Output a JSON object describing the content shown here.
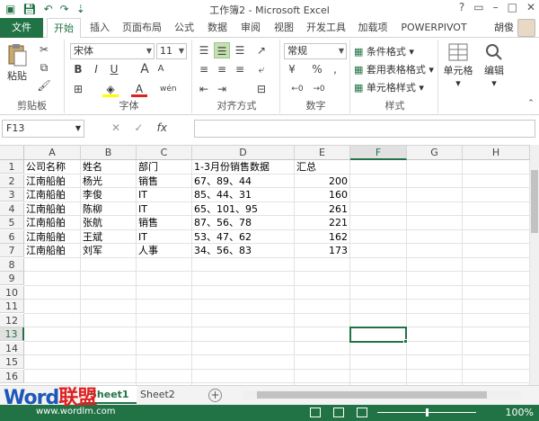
{
  "window": {
    "title": "工作簿2 - Microsoft Excel"
  },
  "tabs": [
    "开始",
    "插入",
    "页面布局",
    "公式",
    "数据",
    "审阅",
    "视图",
    "开发工具",
    "加载项",
    "POWERPIVOT"
  ],
  "file_tab": "文件",
  "user": "胡俊",
  "ribbon": {
    "clipboard": {
      "label": "剪贴板",
      "paste": "粘贴"
    },
    "font": {
      "label": "字体",
      "name": "宋体",
      "size": "11",
      "bold": "B",
      "italic": "I",
      "underline": "U",
      "grow": "A",
      "shrink": "A",
      "color_letter": "A",
      "ex": "wén"
    },
    "align": {
      "label": "对齐方式"
    },
    "number": {
      "label": "数字",
      "format": "常规",
      "percent": "%",
      "comma": ","
    },
    "styles": {
      "label": "样式",
      "cond": "条件格式",
      "table": "套用表格格式",
      "cell": "单元格样式"
    },
    "cells": {
      "label": "单元格"
    },
    "edit": {
      "label": "编辑"
    }
  },
  "formula_bar": {
    "name_box": "F13",
    "fx": "fx",
    "value": ""
  },
  "grid": {
    "columns": [
      "A",
      "B",
      "C",
      "D",
      "E",
      "F",
      "G",
      "H"
    ],
    "rows": [
      "1",
      "2",
      "3",
      "4",
      "5",
      "6",
      "7",
      "8",
      "9",
      "10",
      "11",
      "12",
      "13",
      "14",
      "15",
      "16"
    ],
    "cells": [
      [
        "公司名称",
        "姓名",
        "部门",
        "1-3月份销售数据",
        "汇总"
      ],
      [
        "江南船舶",
        "杨光",
        "销售",
        "67、89、44",
        "200"
      ],
      [
        "江南船舶",
        "李俊",
        "IT",
        "85、44、31",
        "160"
      ],
      [
        "江南船舶",
        "陈柳",
        "IT",
        "65、101、95",
        "261"
      ],
      [
        "江南船舶",
        "张航",
        "销售",
        "87、56、78",
        "221"
      ],
      [
        "江南船舶",
        "王斌",
        "IT",
        "53、47、62",
        "162"
      ],
      [
        "江南船舶",
        "刘军",
        "人事",
        "34、56、83",
        "173"
      ]
    ],
    "selected": "F13"
  },
  "sheets": [
    "Sheet1",
    "Sheet2"
  ],
  "active_sheet": "Sheet1",
  "status": {
    "zoom": "100%"
  },
  "watermark": {
    "word": "Word",
    "cn": "联盟",
    "url": "www.wordlm.com"
  },
  "colors": {
    "accent": "#217346"
  }
}
